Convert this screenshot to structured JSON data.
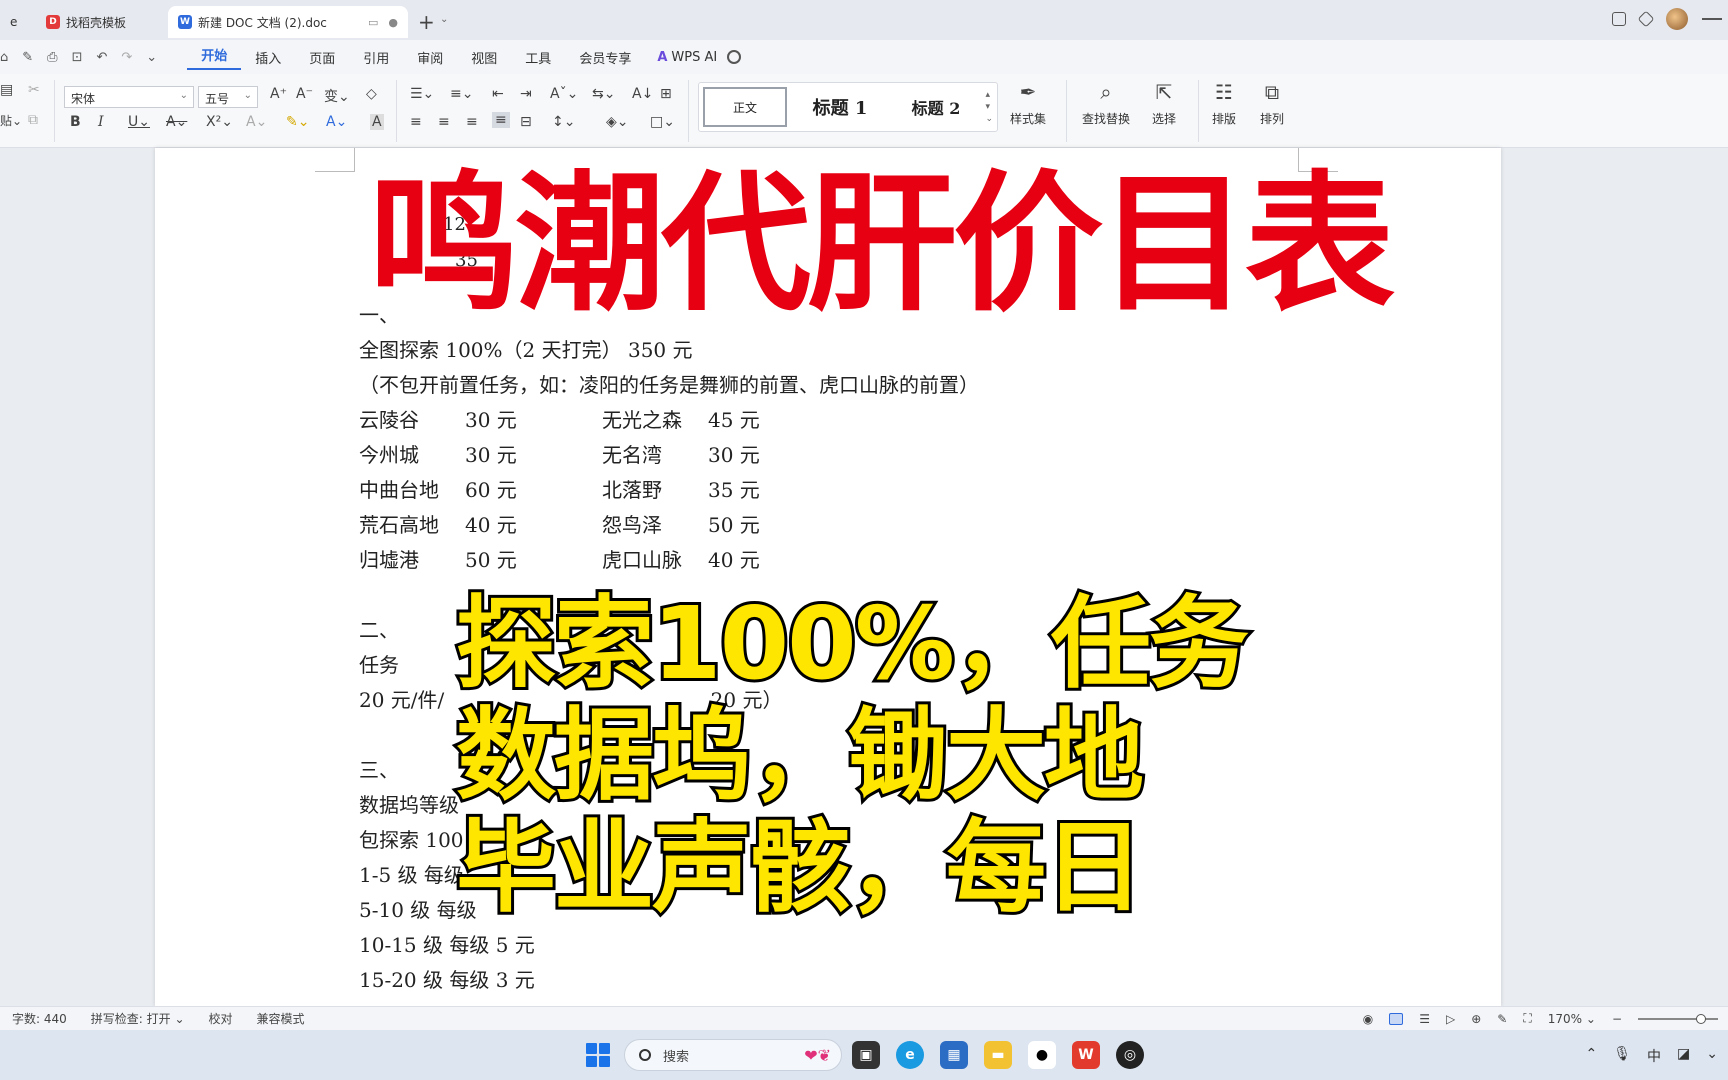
{
  "titlebar": {
    "tabs": [
      {
        "label": "e"
      },
      {
        "label": "找稻壳模板"
      },
      {
        "label": "新建 DOC 文档 (2).doc"
      }
    ],
    "new_tab": "+"
  },
  "menubar": {
    "items": [
      "开始",
      "插入",
      "页面",
      "引用",
      "审阅",
      "视图",
      "工具",
      "会员专享"
    ],
    "active": "开始",
    "wps_ai": "WPS AI"
  },
  "ribbon": {
    "font_name": "宋体",
    "font_size": "五号",
    "styles": {
      "normal": "正文",
      "h1": "标题 1",
      "h2": "标题 2"
    },
    "style_set": "样式集",
    "find_replace": "查找替换",
    "select": "选择",
    "layout": "排版",
    "arrange": "排列"
  },
  "document": {
    "ghost_chars": [
      "12",
      "35"
    ],
    "section1_heading": "一、",
    "full_explore": "全图探索 100%（2 天打完） 350 元",
    "note": "（不包开前置任务，如：凌阳的任务是舞狮的前置、虎口山脉的前置）",
    "locations": [
      {
        "left_name": "云陵谷",
        "left_price": "30 元",
        "right_name": "无光之森",
        "right_price": "45 元"
      },
      {
        "left_name": "今州城",
        "left_price": "30 元",
        "right_name": "无名湾",
        "right_price": "30 元"
      },
      {
        "left_name": "中曲台地",
        "left_price": "60 元",
        "right_name": "北落野",
        "right_price": "35 元"
      },
      {
        "left_name": "荒石高地",
        "left_price": "40 元",
        "right_name": "怨鸟泽",
        "right_price": "50 元"
      },
      {
        "left_name": "归墟港",
        "left_price": "50 元",
        "right_name": "虎口山脉",
        "right_price": "40 元"
      }
    ],
    "section2_heading": "二、",
    "task_label": "任务",
    "task_price": "20 元/件/",
    "task_tail": "20 元）",
    "section3_heading": "三、",
    "echo_line": "数据坞等级",
    "explore_pkg": "包探索 100",
    "lvl_1_5": "1-5 级  每级",
    "lvl_5_10": "5-10 级  每级",
    "lvl_10_15": "10-15 级  每级 5 元",
    "lvl_15_20": "15-20 级  每级 3 元"
  },
  "overlay": {
    "headline": "鸣潮代肝价目表",
    "line1": "探索100%，任务",
    "line2": "数据坞，锄大地",
    "line3": "毕业声骸，每日",
    "headline_color": "#e60012",
    "subtitle_color": "#ffe600"
  },
  "statusbar": {
    "word_count": "字数: 440",
    "spell_check": "拼写检查: 打开",
    "proofread": "校对",
    "compat_mode": "兼容模式",
    "zoom": "170%"
  },
  "taskbar": {
    "search_placeholder": "搜索"
  }
}
